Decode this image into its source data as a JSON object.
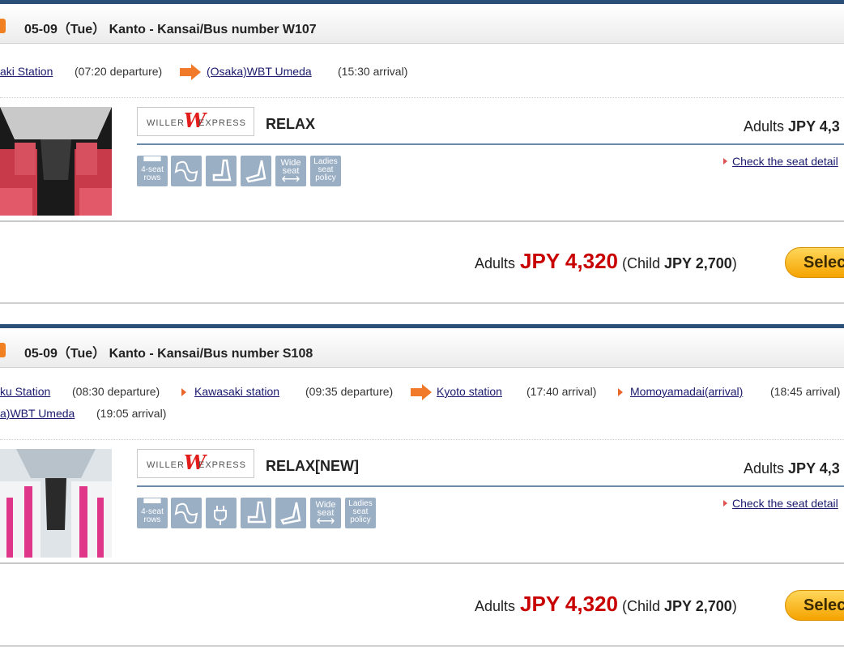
{
  "buses": [
    {
      "header": "05-09（Tue） Kanto - Kansai/Bus number W107",
      "route_line1": {
        "stop1": "aki Station",
        "time1": "(07:20 departure)",
        "stop2": "(Osaka)WBT Umeda",
        "time2": "(15:30 arrival)"
      },
      "logo": {
        "left": "WILLER",
        "w": "W",
        "right": "EXPRESS"
      },
      "plan": "RELAX",
      "adults_label": "Adults",
      "adults_price_cut": "JPY 4,3",
      "seat_link": "Check the seat detail",
      "icons": [
        {
          "name": "4-seat-rows-icon",
          "l1": "▀▀▀",
          "l2": "4-seat",
          "l3": "rows"
        },
        {
          "name": "recline-icon",
          "l1": "",
          "l2": "",
          "l3": ""
        },
        {
          "name": "seat-icon",
          "l1": "",
          "l2": "",
          "l3": ""
        },
        {
          "name": "leg-rest-icon",
          "l1": "",
          "l2": "",
          "l3": ""
        },
        {
          "name": "wide-seat-icon",
          "l1": "Wide",
          "l2": "seat",
          "l3": "⟷"
        },
        {
          "name": "ladies-seat-policy-icon",
          "l1": "Ladies",
          "l2": "seat",
          "l3": "policy"
        }
      ],
      "price": {
        "label": "Adults",
        "amount": "JPY 4,320",
        "child_open": "(Child ",
        "child_amount": "JPY 2,700",
        "child_close": ")"
      },
      "select_label": "Selec"
    },
    {
      "header": "05-09（Tue） Kanto - Kansai/Bus number S108",
      "route_line1": {
        "stop1": "ku Station",
        "time1": "(08:30 departure)",
        "stop2": "Kawasaki station",
        "time2": "(09:35 departure)",
        "stop3": "Kyoto station",
        "time3": "(17:40 arrival)",
        "stop4": "Momoyamadai(arrival)",
        "time4": "(18:45 arrival)"
      },
      "route_line2": {
        "stop5": "a)WBT Umeda",
        "time5": "(19:05 arrival)"
      },
      "logo": {
        "left": "WILLER",
        "w": "W",
        "right": "EXPRESS"
      },
      "plan": "RELAX[NEW]",
      "adults_label": "Adults",
      "adults_price_cut": "JPY 4,3",
      "seat_link": "Check the seat detail",
      "icons": [
        {
          "name": "4-seat-rows-icon",
          "l1": "▀▀▀",
          "l2": "4-seat",
          "l3": "rows"
        },
        {
          "name": "recline-icon",
          "l1": "",
          "l2": "",
          "l3": ""
        },
        {
          "name": "power-outlet-icon",
          "l1": "",
          "l2": "",
          "l3": ""
        },
        {
          "name": "seat-icon",
          "l1": "",
          "l2": "",
          "l3": ""
        },
        {
          "name": "leg-rest-icon",
          "l1": "",
          "l2": "",
          "l3": ""
        },
        {
          "name": "wide-seat-icon",
          "l1": "Wide",
          "l2": "seat",
          "l3": "⟷"
        },
        {
          "name": "ladies-seat-policy-icon",
          "l1": "Ladies",
          "l2": "seat",
          "l3": "policy"
        }
      ],
      "price": {
        "label": "Adults",
        "amount": "JPY 4,320",
        "child_open": "(Child ",
        "child_amount": "JPY 2,700",
        "child_close": ")"
      },
      "select_label": "Selec"
    }
  ],
  "colors": {
    "accent_orange": "#f08020",
    "price_red": "#c80000",
    "header_border": "#2c4f78",
    "icon_bg": "#9aaec4",
    "link": "#1a1a6e"
  }
}
